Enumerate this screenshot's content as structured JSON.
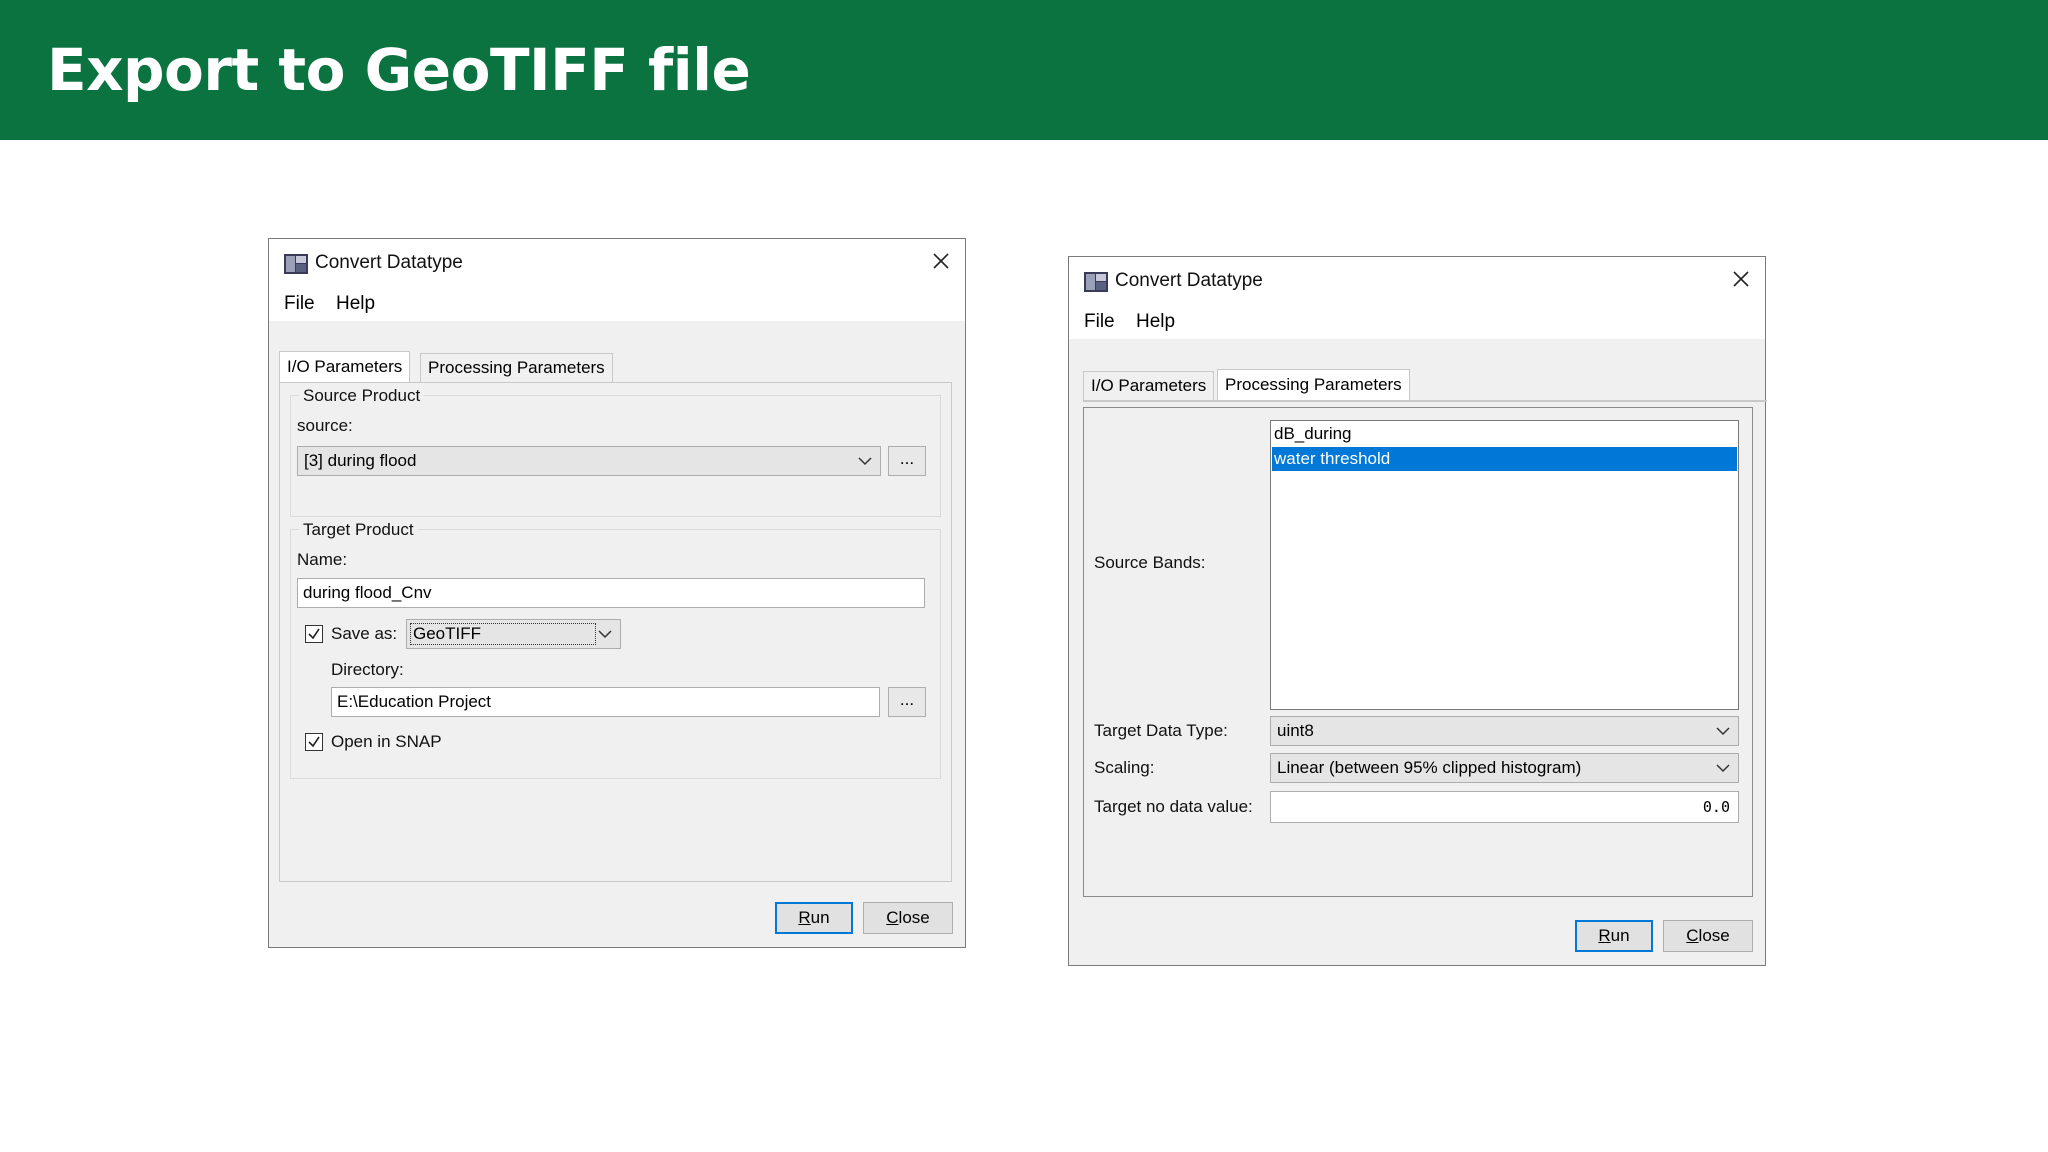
{
  "slide_title": "Export to GeoTIFF file",
  "dialog_left": {
    "title": "Convert Datatype",
    "menu": [
      "File",
      "Help"
    ],
    "tabs": [
      "I/O Parameters",
      "Processing Parameters"
    ],
    "active_tab": "I/O Parameters",
    "source_group": {
      "title": "Source Product",
      "source_label": "source:",
      "source_value": "[3] during flood",
      "browse_label": "..."
    },
    "target_group": {
      "title": "Target Product",
      "name_label": "Name:",
      "name_value": "during flood_Cnv",
      "save_as_label": "Save as:",
      "save_as_checked": true,
      "format_value": "GeoTIFF",
      "directory_label": "Directory:",
      "directory_value": "E:\\Education Project",
      "browse_label": "...",
      "open_in_snap_label": "Open in SNAP",
      "open_in_snap_checked": true
    },
    "buttons": {
      "run_prefix": "R",
      "run_rest": "un",
      "close_prefix": "C",
      "close_rest": "lose"
    }
  },
  "dialog_right": {
    "title": "Convert Datatype",
    "menu": [
      "File",
      "Help"
    ],
    "tabs": [
      "I/O Parameters",
      "Processing Parameters"
    ],
    "active_tab": "Processing Parameters",
    "source_bands_label": "Source Bands:",
    "source_bands": [
      "dB_during",
      "water threshold"
    ],
    "selected_band": "water threshold",
    "target_data_type_label": "Target Data Type:",
    "target_data_type_value": "uint8",
    "scaling_label": "Scaling:",
    "scaling_value": "Linear (between 95% clipped histogram)",
    "no_data_label": "Target no data value:",
    "no_data_value": "0.0",
    "buttons": {
      "run_prefix": "R",
      "run_rest": "un",
      "close_prefix": "C",
      "close_rest": "lose"
    }
  },
  "colors": {
    "banner": "#0b7340",
    "selection": "#0078d7",
    "dialog_bg": "#f0f0f0"
  }
}
